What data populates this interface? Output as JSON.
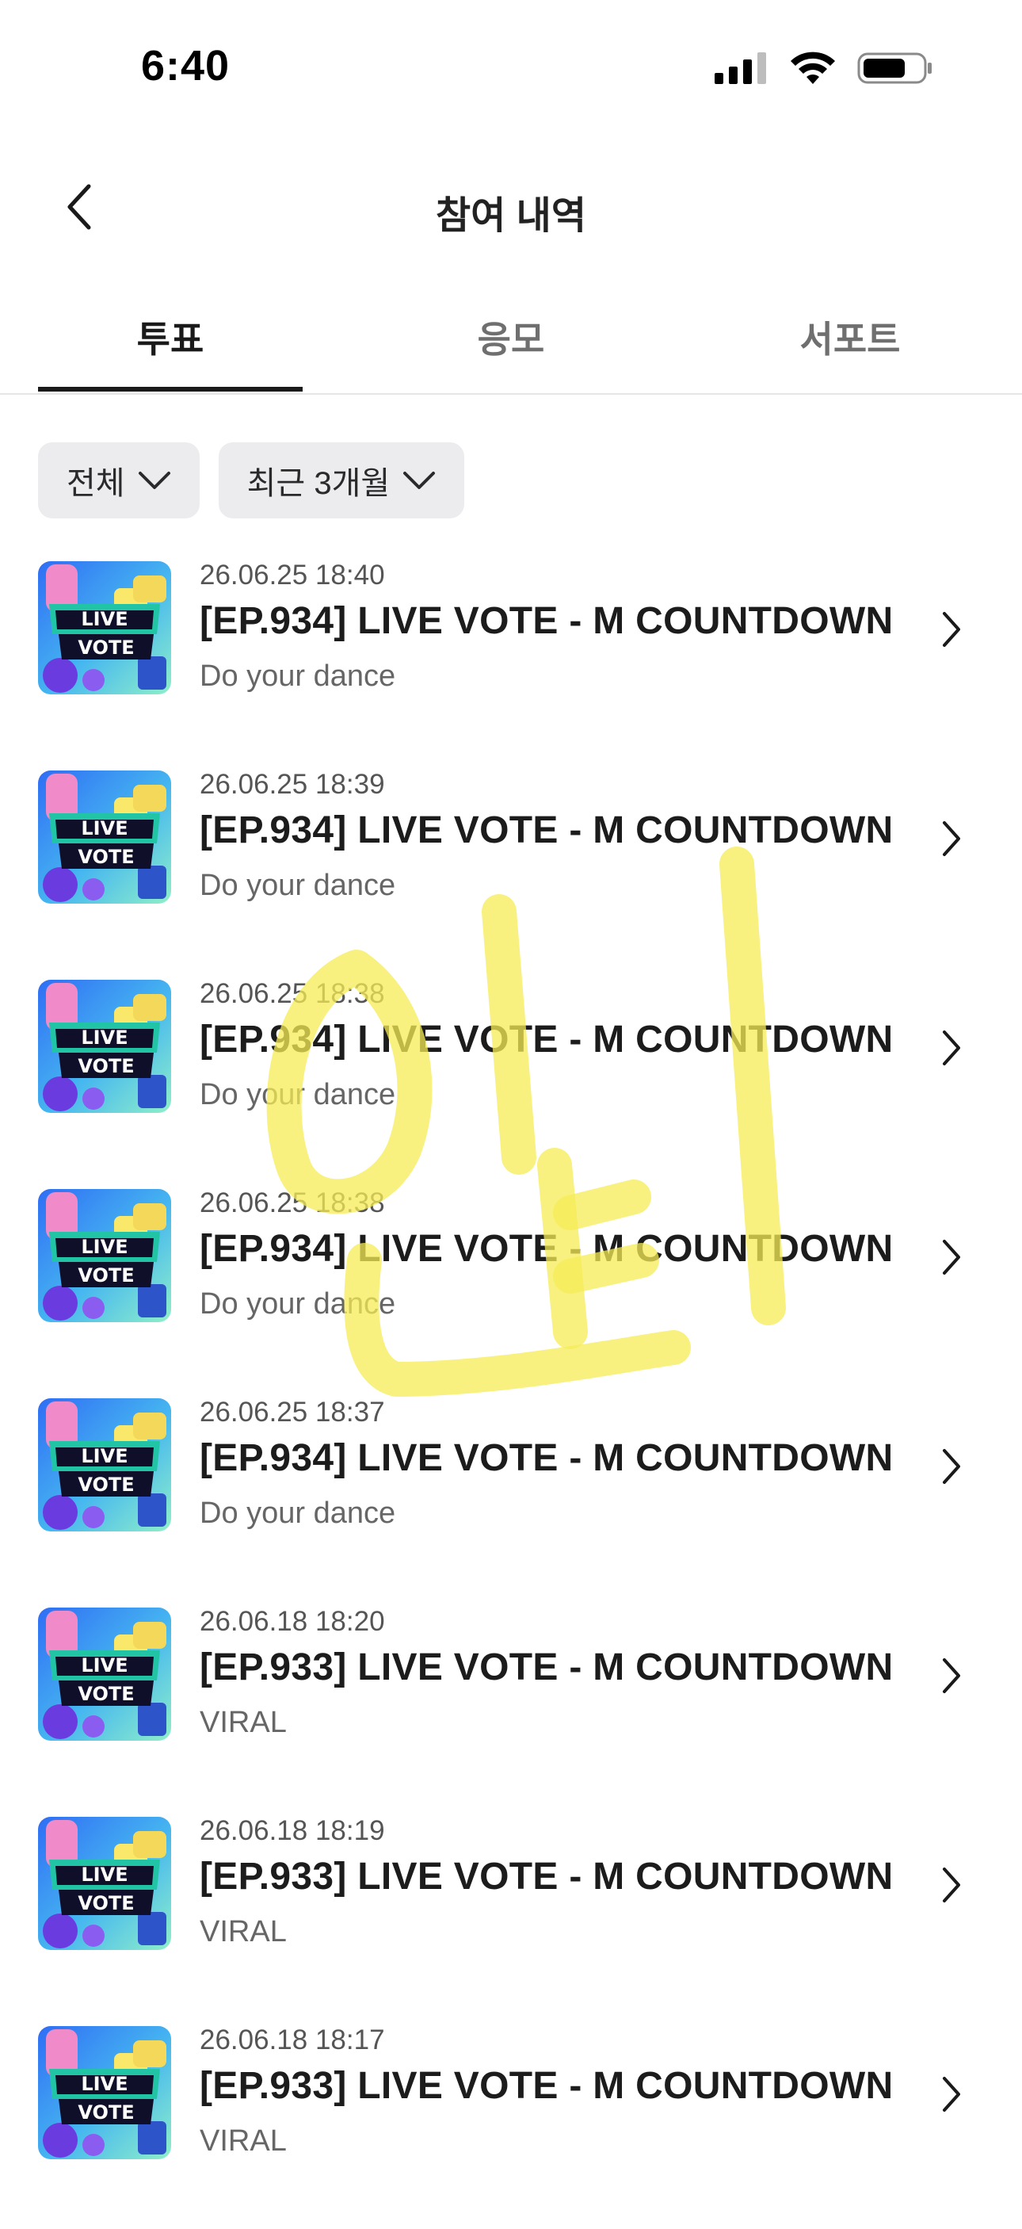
{
  "status_bar": {
    "time": "6:40"
  },
  "header": {
    "title": "참여 내역"
  },
  "tabs": [
    {
      "label": "투표",
      "active": true
    },
    {
      "label": "응모",
      "active": false
    },
    {
      "label": "서포트",
      "active": false
    }
  ],
  "filters": [
    {
      "label": "전체"
    },
    {
      "label": "최근 3개월"
    }
  ],
  "items": [
    {
      "date": "26.06.25 18:40",
      "title": "[EP.934] LIVE VOTE - M COUNTDOWN",
      "subtitle": "Do your dance"
    },
    {
      "date": "26.06.25 18:39",
      "title": "[EP.934] LIVE VOTE - M COUNTDOWN",
      "subtitle": "Do your dance"
    },
    {
      "date": "26.06.25 18:38",
      "title": "[EP.934] LIVE VOTE - M COUNTDOWN",
      "subtitle": "Do your dance"
    },
    {
      "date": "26.06.25 18:38",
      "title": "[EP.934] LIVE VOTE - M COUNTDOWN",
      "subtitle": "Do your dance"
    },
    {
      "date": "26.06.25 18:37",
      "title": "[EP.934] LIVE VOTE - M COUNTDOWN",
      "subtitle": "Do your dance"
    },
    {
      "date": "26.06.18 18:20",
      "title": "[EP.933] LIVE VOTE - M COUNTDOWN",
      "subtitle": "VIRAL"
    },
    {
      "date": "26.06.18 18:19",
      "title": "[EP.933] LIVE VOTE - M COUNTDOWN",
      "subtitle": "VIRAL"
    },
    {
      "date": "26.06.18 18:17",
      "title": "[EP.933] LIVE VOTE - M COUNTDOWN",
      "subtitle": "VIRAL"
    }
  ],
  "thumbnail": {
    "line1": "LIVE",
    "line2": "VOTE"
  },
  "watermark": {
    "text": "민티",
    "color": "#f5ec55"
  },
  "colors": {
    "accent": "#1a1a1a",
    "chip_bg": "#ececef",
    "divider": "#e6e6e6"
  },
  "icons": {
    "back": "chevron-left-icon",
    "row": "chevron-right-icon",
    "dropdown": "chevron-down-icon",
    "signal": "cellular-signal-icon",
    "wifi": "wifi-icon",
    "battery": "battery-icon"
  }
}
